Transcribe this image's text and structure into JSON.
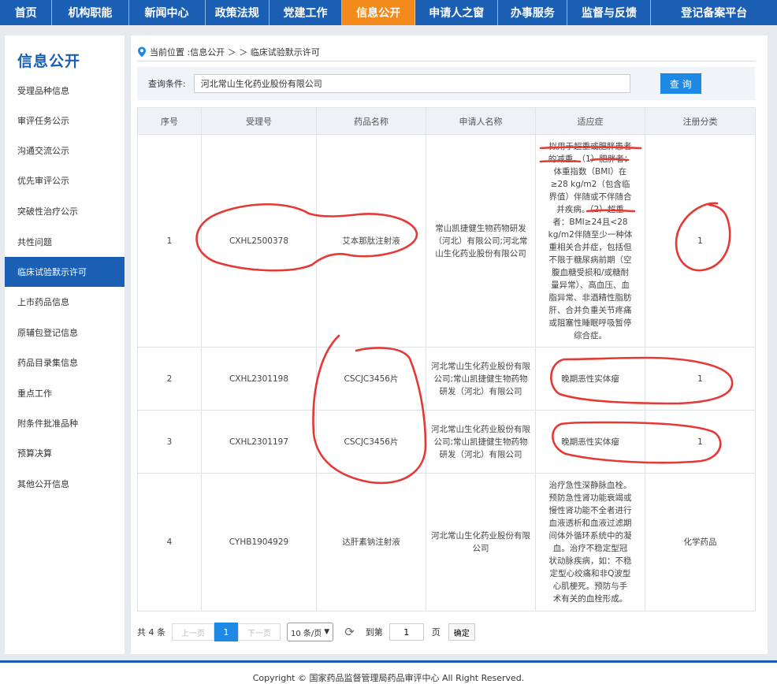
{
  "nav": [
    {
      "label": "首页",
      "active": false
    },
    {
      "label": "机构职能",
      "active": false
    },
    {
      "label": "新闻中心",
      "active": false
    },
    {
      "label": "政策法规",
      "active": false
    },
    {
      "label": "党建工作",
      "active": false
    },
    {
      "label": "信息公开",
      "active": true
    },
    {
      "label": "申请人之窗",
      "active": false
    },
    {
      "label": "办事服务",
      "active": false
    },
    {
      "label": "监督与反馈",
      "active": false
    },
    {
      "label": "登记备案平台",
      "active": false
    }
  ],
  "sidebar": {
    "title": "信息公开",
    "items": [
      {
        "label": "受理品种信息",
        "active": false
      },
      {
        "label": "审评任务公示",
        "active": false
      },
      {
        "label": "沟通交流公示",
        "active": false
      },
      {
        "label": "优先审评公示",
        "active": false
      },
      {
        "label": "突破性治疗公示",
        "active": false
      },
      {
        "label": "共性问题",
        "active": false
      },
      {
        "label": "临床试验默示许可",
        "active": true
      },
      {
        "label": "上市药品信息",
        "active": false
      },
      {
        "label": "原辅包登记信息",
        "active": false
      },
      {
        "label": "药品目录集信息",
        "active": false
      },
      {
        "label": "重点工作",
        "active": false
      },
      {
        "label": "附条件批准品种",
        "active": false
      },
      {
        "label": "预算决算",
        "active": false
      },
      {
        "label": "其他公开信息",
        "active": false
      }
    ]
  },
  "breadcrumb": {
    "prefix": "当前位置 : ",
    "path": "信息公开 ＞ ＞ 临床试验默示许可"
  },
  "search": {
    "label": "查询条件:",
    "value": "河北常山生化药业股份有限公司",
    "button": "查 询"
  },
  "table": {
    "headers": [
      "序号",
      "受理号",
      "药品名称",
      "申请人名称",
      "适应症",
      "注册分类"
    ],
    "rows": [
      {
        "no": "1",
        "acceptance_no": "CXHL2500378",
        "drug": "艾本那肽注射液",
        "applicant": "常山凯捷健生物药物研发（河北）有限公司;河北常山生化药业股份有限公司",
        "indication": [
          "拟用于超重或肥胖患者",
          "的减重。（1）肥胖者：",
          "体重指数（BMI）在",
          "≥28 kg/m2（包含临",
          "界值）伴随或不伴随合",
          "并疾病。（2）超重",
          "者：BMI≥24且<28",
          "kg/m2伴随至少一种体",
          "重相关合并症，包括但",
          "不限于糖尿病前期（空",
          "腹血糖受损和/或糖耐",
          "量异常）、高血压、血",
          "脂异常、非酒精性脂肪",
          "肝、合并负重关节疼痛",
          "或阻塞性睡眠呼吸暂停",
          "综合症。"
        ],
        "category": "1"
      },
      {
        "no": "2",
        "acceptance_no": "CXHL2301198",
        "drug": "CSCJC3456片",
        "applicant": "河北常山生化药业股份有限公司;常山凯捷健生物药物研发（河北）有限公司",
        "indication": [
          "晚期恶性实体瘤"
        ],
        "category": "1"
      },
      {
        "no": "3",
        "acceptance_no": "CXHL2301197",
        "drug": "CSCJC3456片",
        "applicant": "河北常山生化药业股份有限公司;常山凯捷健生物药物研发（河北）有限公司",
        "indication": [
          "晚期恶性实体瘤"
        ],
        "category": "1"
      },
      {
        "no": "4",
        "acceptance_no": "CYHB1904929",
        "drug": "达肝素钠注射液",
        "applicant": "河北常山生化药业股份有限公司",
        "indication": [
          "治疗急性深静脉血栓。",
          "预防急性肾功能衰竭或",
          "慢性肾功能不全者进行",
          "血液透析和血液过滤期",
          "间体外循环系统中的凝",
          "血。治疗不稳定型冠",
          "状动脉疾病，如：不稳",
          "定型心绞痛和非Q波型",
          "心肌梗死。预防与手",
          "术有关的血栓形成。"
        ],
        "category": "化学药品"
      }
    ]
  },
  "pager": {
    "total": "共 4 条",
    "prev": "上一页",
    "page": "1",
    "next": "下一页",
    "size": "10 条/页",
    "refresh_icon": "refresh-icon",
    "goto_label": "到第",
    "goto_value": "1",
    "goto_unit": "页",
    "ok": "确定"
  },
  "footer": {
    "text": "Copyright © 国家药品监督管理局药品审评中心   All Right Reserved."
  },
  "colors": {
    "primary": "#1a5fb4",
    "active_tab": "#f28a1c",
    "button": "#1e88e5",
    "annotation": "#e53935"
  }
}
